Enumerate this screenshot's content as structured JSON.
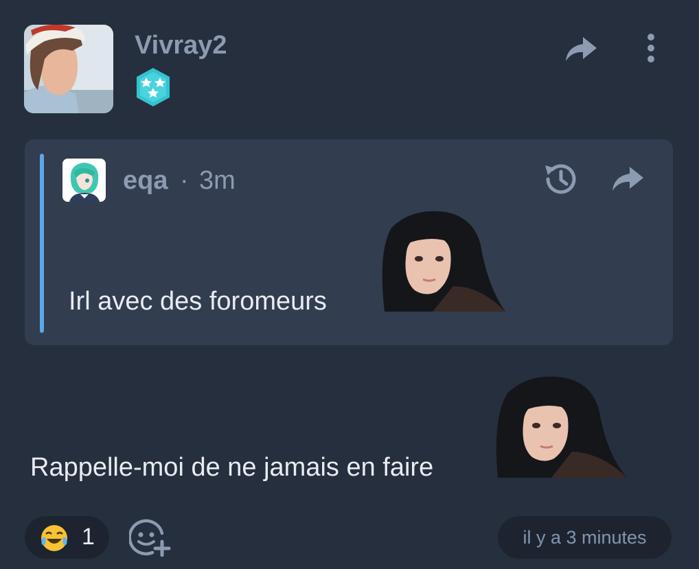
{
  "post": {
    "author": "Vivray2",
    "badge_icon": "three-stars-badge-icon",
    "text": "Rappelle-moi de ne jamais en faire",
    "timestamp": "il y a 3 minutes"
  },
  "quote": {
    "author": "eqa",
    "separator": "·",
    "time": "3m",
    "text": "Irl avec des foromeurs"
  },
  "reactions": [
    {
      "emoji": "tears-of-joy-emoji",
      "count": "1"
    }
  ],
  "colors": {
    "background": "#262f3d",
    "quote_background": "#323d4f",
    "quote_accent": "#5ba7e8",
    "muted_text": "#8c9bb2",
    "badge": "#33c4d0"
  }
}
